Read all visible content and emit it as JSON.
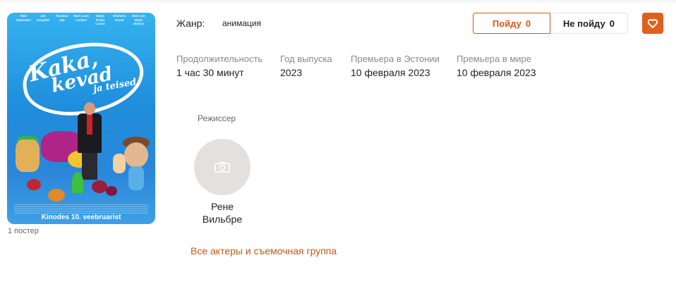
{
  "poster": {
    "cast_names": [
      "Mait Malmsten",
      "Jan Uuspõld",
      "Rasmus Oja",
      "Mart Lumi Lember",
      "Marje Pruks Luuss",
      "Elisheva Ermel",
      "Mari-Liis Matsi Jürjens"
    ],
    "logo_line1": "Kaka,",
    "logo_line2": "kevad",
    "logo_line3": "ja teised.",
    "release_text": "Kinodes 10. veebruarist",
    "count_label": "1 постер"
  },
  "genre": {
    "label": "Жанр:",
    "value": "анимация"
  },
  "actions": {
    "go_label": "Пойду",
    "go_count": "0",
    "nogo_label": "Не пойду",
    "nogo_count": "0",
    "favorite_icon": "heart-icon",
    "accent_color": "#e0601e"
  },
  "facts": [
    {
      "label": "Продолжительность",
      "value": "1 час 30 минут"
    },
    {
      "label": "Год выпуска",
      "value": "2023"
    },
    {
      "label": "Премьера в Эстонии",
      "value": "10 февраля 2023"
    },
    {
      "label": "Премьера в мире",
      "value": "10 февраля 2023"
    }
  ],
  "crew": {
    "role": "Режиссер",
    "name_line1": "Рене",
    "name_line2": "Вильбре",
    "avatar_icon": "camera-icon",
    "all_link": "Все актеры и съемочная группа"
  }
}
